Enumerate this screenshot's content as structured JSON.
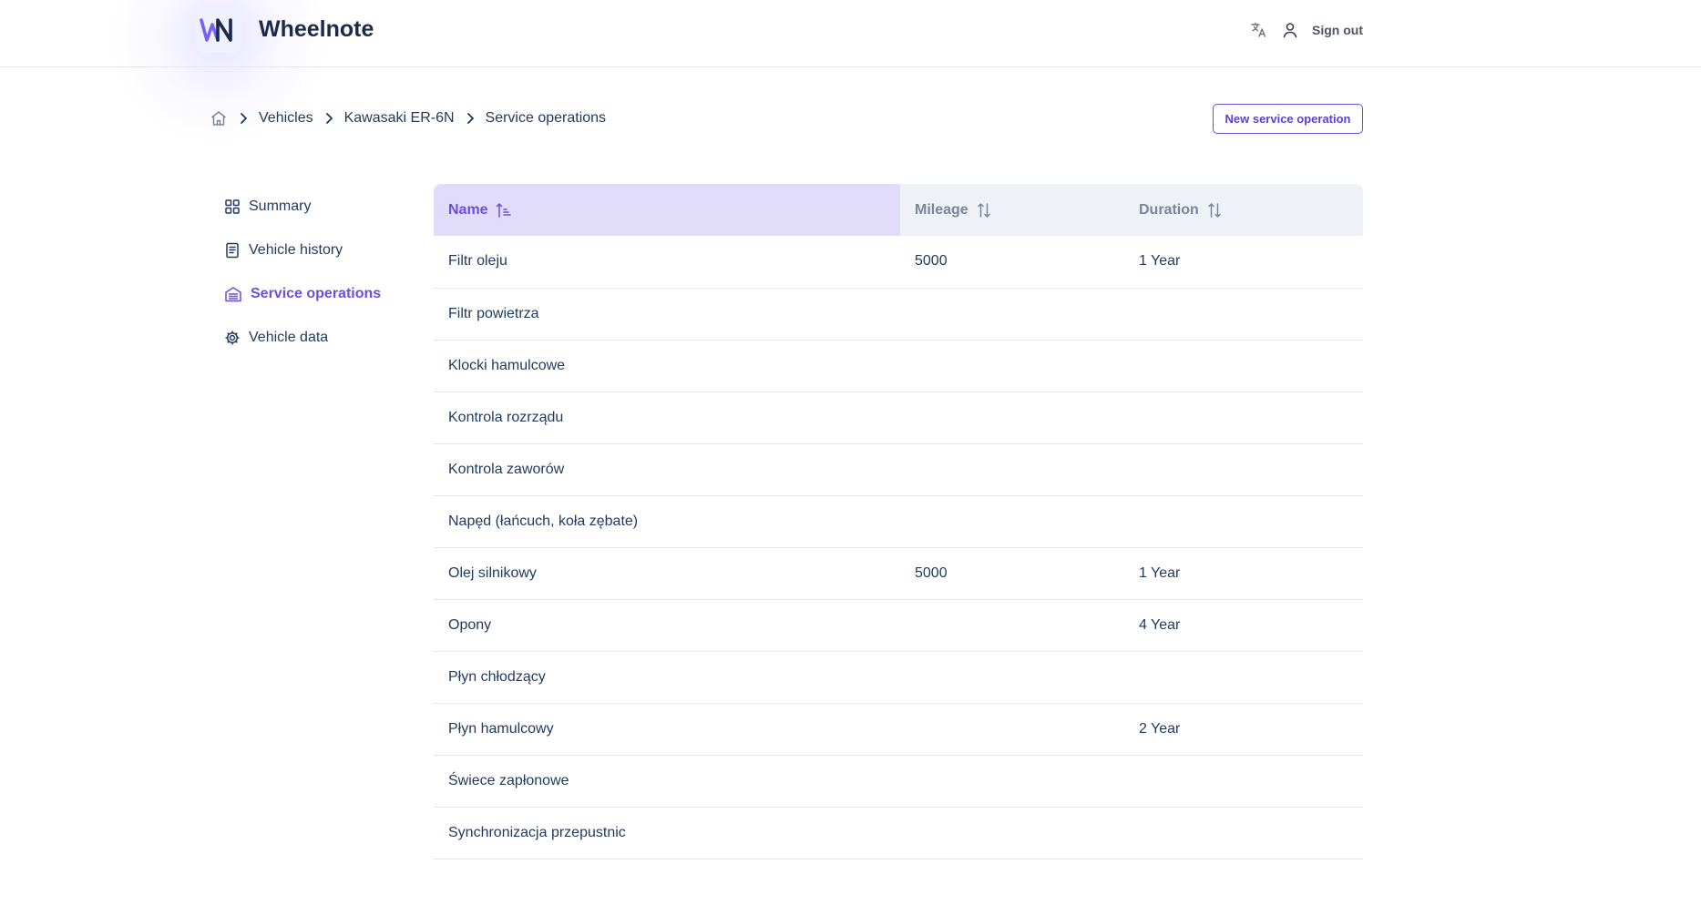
{
  "app": {
    "logo_text": "WN",
    "title": "Wheelnote"
  },
  "header": {
    "sign_out_label": "Sign out",
    "language_icon": "translate-icon",
    "user_icon": "user-icon"
  },
  "breadcrumb": {
    "home_icon": "home-icon",
    "items": [
      "Vehicles",
      "Kawasaki ER-6N",
      "Service operations"
    ]
  },
  "actions": {
    "new_service_operation": "New service operation"
  },
  "sidebar": {
    "items": [
      {
        "label": "Summary",
        "icon": "grid-icon",
        "active": false
      },
      {
        "label": "Vehicle history",
        "icon": "document-icon",
        "active": false
      },
      {
        "label": "Service operations",
        "icon": "garage-icon",
        "active": true
      },
      {
        "label": "Vehicle data",
        "icon": "gear-icon",
        "active": false
      }
    ]
  },
  "table": {
    "columns": [
      {
        "label": "Name",
        "sort": "ascending"
      },
      {
        "label": "Mileage",
        "sort": "none"
      },
      {
        "label": "Duration",
        "sort": "none"
      }
    ],
    "rows": [
      {
        "name": "Filtr oleju",
        "mileage": "5000",
        "duration": "1 Year"
      },
      {
        "name": "Filtr powietrza",
        "mileage": "",
        "duration": ""
      },
      {
        "name": "Klocki hamulcowe",
        "mileage": "",
        "duration": ""
      },
      {
        "name": "Kontrola rozrządu",
        "mileage": "",
        "duration": ""
      },
      {
        "name": "Kontrola zaworów",
        "mileage": "",
        "duration": ""
      },
      {
        "name": "Napęd (łańcuch, koła zębate)",
        "mileage": "",
        "duration": ""
      },
      {
        "name": "Olej silnikowy",
        "mileage": "5000",
        "duration": "1 Year"
      },
      {
        "name": "Opony",
        "mileage": "",
        "duration": "4 Year"
      },
      {
        "name": "Płyn chłodzący",
        "mileage": "",
        "duration": ""
      },
      {
        "name": "Płyn hamulcowy",
        "mileage": "",
        "duration": "2 Year"
      },
      {
        "name": "Świece zapłonowe",
        "mileage": "",
        "duration": ""
      },
      {
        "name": "Synchronizacja przepustnic",
        "mileage": "",
        "duration": ""
      }
    ]
  },
  "colors": {
    "accent": "#6b4fd8",
    "text": "#1e3a5f",
    "header_bg": "#eef1f6",
    "sorted_header_bg": "#e2dcfb"
  }
}
